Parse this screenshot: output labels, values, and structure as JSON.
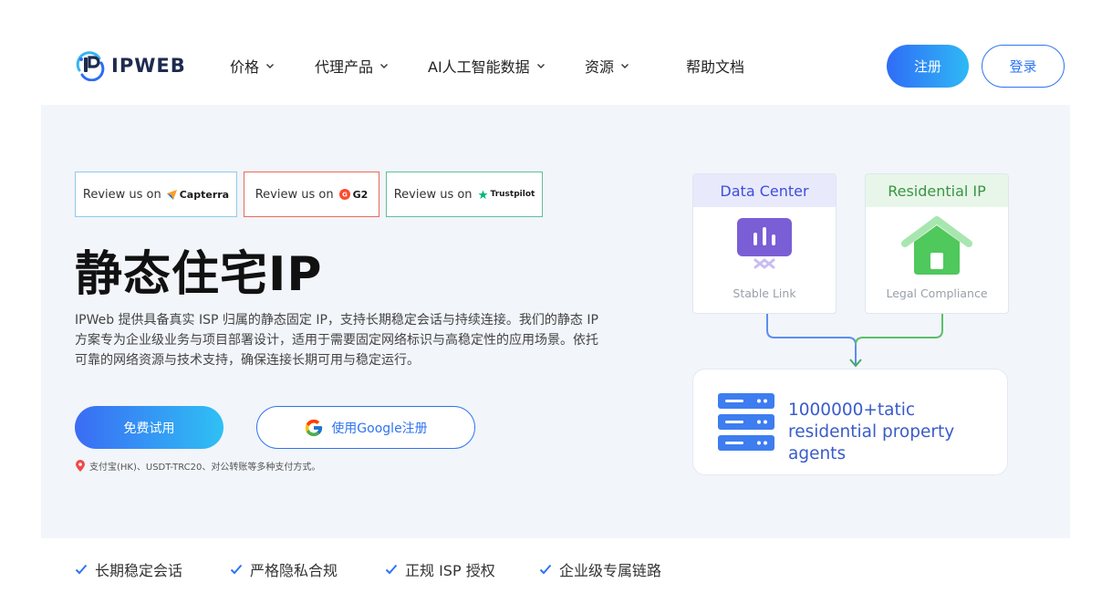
{
  "brand": {
    "name": "IPWEB"
  },
  "nav": {
    "items": [
      {
        "label": "价格",
        "has_dropdown": true
      },
      {
        "label": "代理产品",
        "has_dropdown": true
      },
      {
        "label": "AI人工智能数据",
        "has_dropdown": true
      },
      {
        "label": "资源",
        "has_dropdown": true
      },
      {
        "label": "帮助文档",
        "has_dropdown": false
      }
    ],
    "register_label": "注册",
    "login_label": "登录"
  },
  "reviews": [
    {
      "prefix": "Review us on",
      "brand": "Capterra"
    },
    {
      "prefix": "Review us on",
      "brand": "G2"
    },
    {
      "prefix": "Review us on",
      "brand": "Trustpilot"
    }
  ],
  "hero": {
    "title": "静态住宅IP",
    "description": "IPWeb 提供具备真实 ISP 归属的静态固定 IP，支持长期稳定会话与持续连接。我们的静态 IP 方案专为企业级业务与项目部署设计，适用于需要固定网络标识与高稳定性的应用场景。依托可靠的网络资源与技术支持，确保连接长期可用与稳定运行。",
    "trial_label": "免费试用",
    "google_label": "使用Google注册",
    "payment_note": "支付宝(HK)、USDT-TRC20、对公转账等多种支付方式。"
  },
  "diagram": {
    "card_left": {
      "title": "Data Center",
      "footer": "Stable Link",
      "icon": "presentation-chart-icon"
    },
    "card_right": {
      "title": "Residential IP",
      "footer": "Legal Compliance",
      "icon": "house-icon"
    },
    "agent_text": "1000000+tatic residential property agents",
    "agent_icon": "server-icon"
  },
  "features": [
    "长期稳定会话",
    "严格隐私合规",
    "正规 ISP 授权",
    "企业级专属链路"
  ],
  "colors": {
    "primary": "#2f74f2",
    "hero_bg": "#f2f5fa",
    "data_center": "#3c4fd8",
    "residential": "#3b9443"
  }
}
